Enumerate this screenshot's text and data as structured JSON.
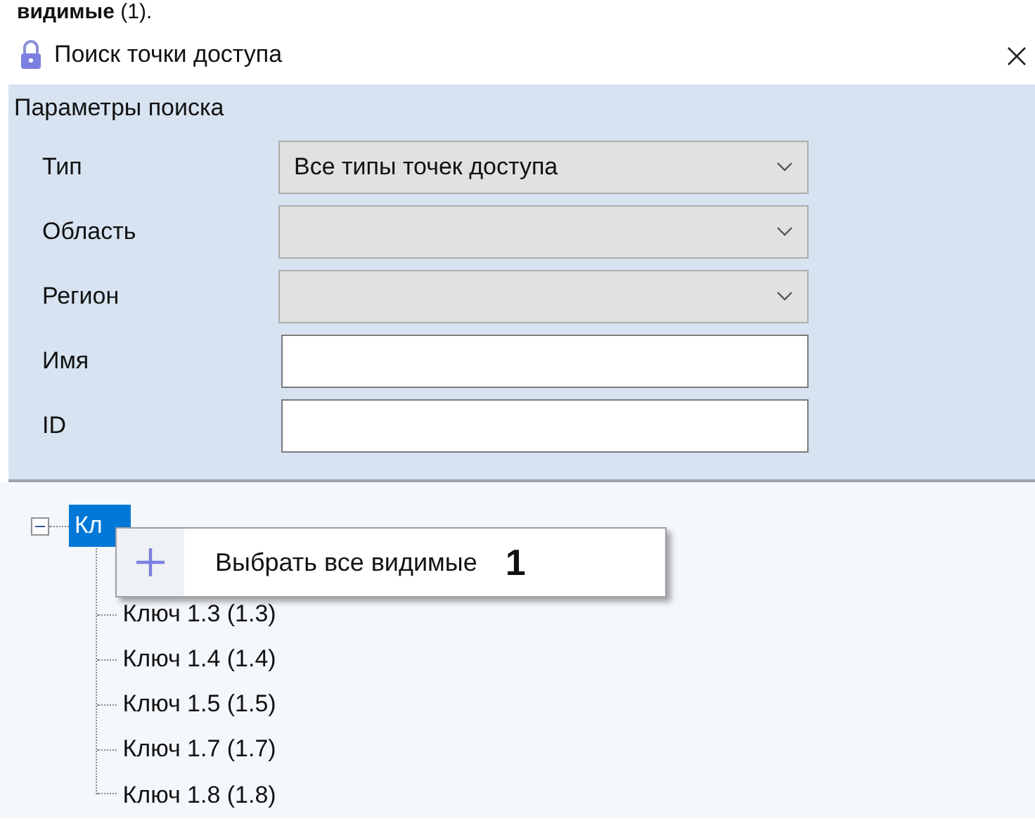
{
  "caption": {
    "text": "**видимые** (1)."
  },
  "window": {
    "title": "Поиск точки доступа"
  },
  "search_panel": {
    "title": "Параметры поиска",
    "fields": [
      {
        "label": "Тип",
        "kind": "combo",
        "value": "Все типы точек доступа"
      },
      {
        "label": "Область",
        "kind": "combo"
      },
      {
        "label": "Регион",
        "kind": "combo"
      },
      {
        "label": "Имя",
        "kind": "text"
      },
      {
        "label": "ID",
        "kind": "text"
      }
    ]
  },
  "tree": {
    "root": {
      "label": "Кл",
      "selected": true,
      "expanded": true,
      "children": [
        {
          "label": "Ключ 1.3 (1.3)"
        },
        {
          "label": "Ключ 1.4 (1.4)"
        },
        {
          "label": "Ключ 1.5 (1.5)"
        },
        {
          "label": "Ключ 1.7 (1.7)"
        },
        {
          "label": "Ключ 1.8 (1.8)"
        }
      ]
    }
  },
  "context_menu": {
    "items": [
      {
        "label": "Выбрать все видимые",
        "callout": "1"
      }
    ]
  }
}
